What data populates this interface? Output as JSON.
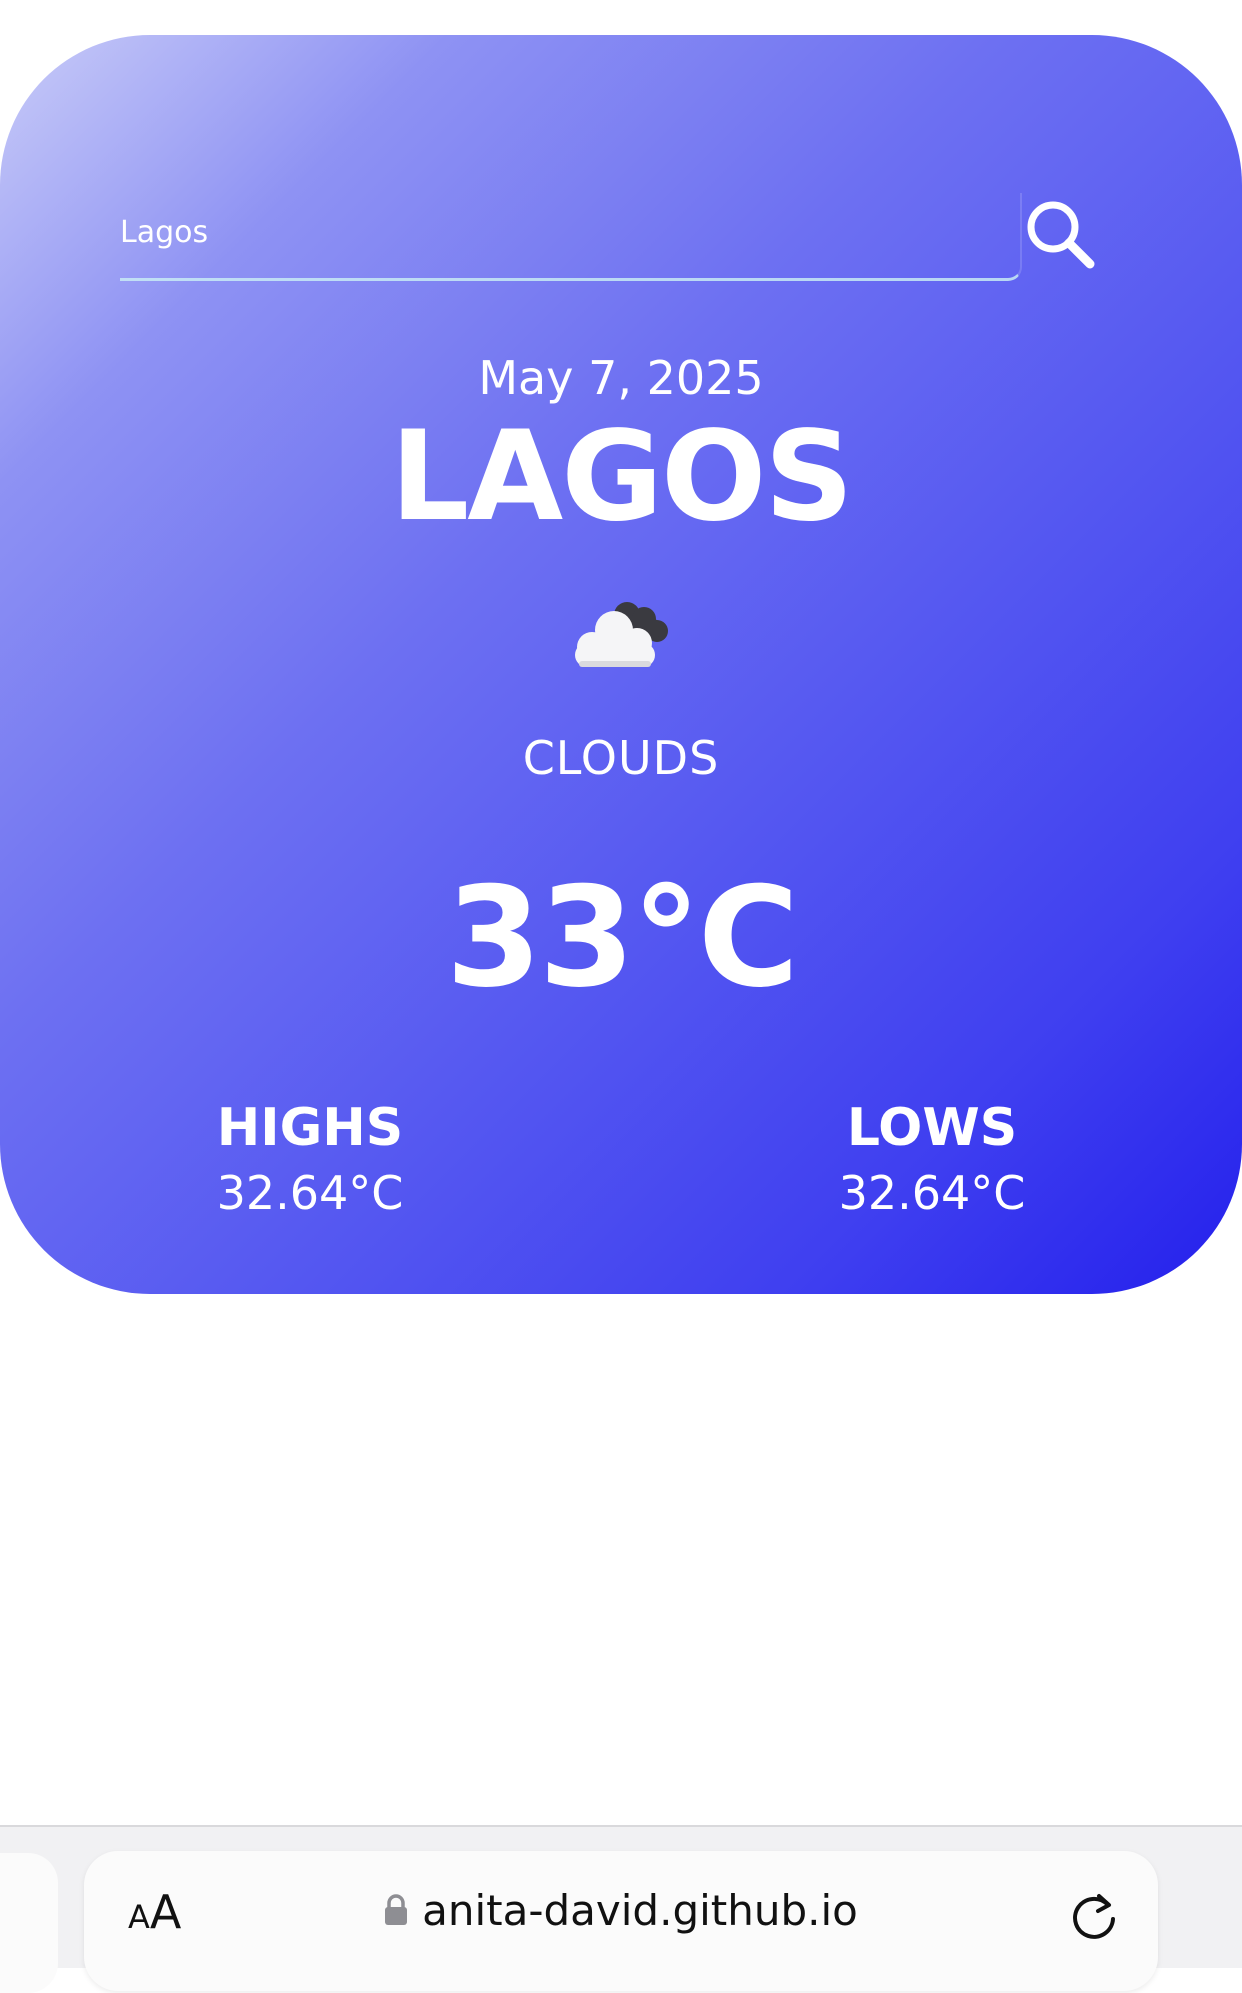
{
  "search": {
    "value": "Lagos",
    "icon": "search-icon"
  },
  "weather": {
    "date": "May 7, 2025",
    "city": "LAGOS",
    "condition_icon": "cloud-icon",
    "condition": "CLOUDS",
    "temperature": "33°C",
    "highs_label": "HIGHS",
    "highs_value": "32.64°C",
    "lows_label": "LOWS",
    "lows_value": "32.64°C"
  },
  "browser": {
    "text_size_small": "A",
    "text_size_big": "A",
    "url": "anita-david.github.io",
    "lock_icon": "lock-icon",
    "reload_icon": "reload-icon"
  },
  "colors": {
    "gradient_start": "#c9ccf8",
    "gradient_mid": "#5457f1",
    "gradient_end": "#2420ec",
    "text": "#ffffff"
  }
}
